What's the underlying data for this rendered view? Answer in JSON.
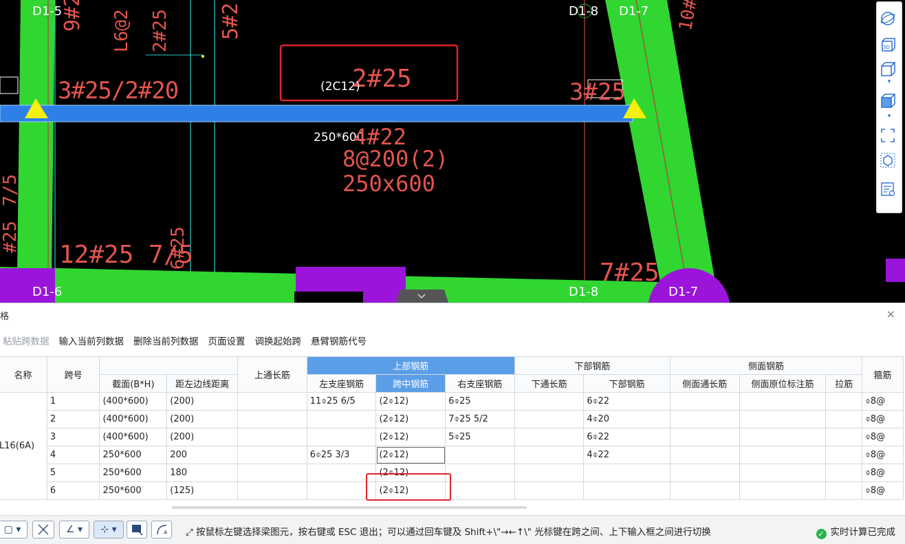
{
  "cad": {
    "axis_labels": [
      "D1-5",
      "D1-8",
      "D1-7",
      "D1-6",
      "D1-8",
      "D1-7"
    ],
    "texts": {
      "beam_top_left": "3#25/2#20",
      "beam_mid_top": "2#25",
      "beam_mid_top_overlay": "(2C12)",
      "beam_top_right": "3#25",
      "section_overlay": "250*600",
      "red_mid1": "4#22",
      "red_mid2": "8@200(2)",
      "red_mid3": "250x600",
      "bottom_left": "12#25 7/5",
      "bottom_left2": "6#25",
      "bottom_right": "7#25",
      "top_left_v1": "9#2",
      "top_left_v2": "L6@2",
      "top_left_v3": "2#25",
      "top_mid_v": "5#2",
      "top_right_v": "10#1",
      "left_v": "7/5",
      "left_v2": "#25"
    },
    "colors": {
      "beam_green": "#31d631",
      "beam_blue": "#2f7fe8",
      "purple": "#9a15d9",
      "red_text": "#e2554e",
      "annotation_box": "#e0242a"
    }
  },
  "right_toolbar": {
    "icons": [
      "orbit-icon",
      "view-3d-icon",
      "cube-wire-icon",
      "cube-solid-icon",
      "fit-view-icon",
      "iso-view-icon",
      "properties-icon"
    ]
  },
  "panel": {
    "title": "格",
    "close": "×",
    "menu": [
      "粘贴跨数据",
      "输入当前列数据",
      "删除当前列数据",
      "页面设置",
      "调换起始跨",
      "悬臂钢筋代号"
    ],
    "headers": {
      "name": "名称",
      "span": "跨号",
      "section": "截面(B*H)",
      "dist": "距左边线距离",
      "top_through": "上通长筋",
      "top_group": "上部钢筋",
      "left_support": "左支座钢筋",
      "mid_span": "跨中钢筋",
      "right_support": "右支座钢筋",
      "bottom_group": "下部钢筋",
      "bottom_through": "下通长筋",
      "bottom_bar": "下部钢筋",
      "side_group": "侧面钢筋",
      "side_through": "侧面通长筋",
      "side_in_place": "侧面原位标注筋",
      "tie": "拉筋",
      "stirrup": "箍筋"
    },
    "beam_name": "L16(6A)",
    "rows": [
      {
        "span": "1",
        "section": "(400*600)",
        "dist": "(200)",
        "top_through": "",
        "left": "11⌽25 6/5",
        "mid": "(2⌽12)",
        "right": "6⌽25",
        "bot_through": "",
        "bot": "6⌽22",
        "side_through": "",
        "side_inplace": "",
        "tie": "",
        "stirrup": "⌽8@"
      },
      {
        "span": "2",
        "section": "(400*600)",
        "dist": "(200)",
        "top_through": "",
        "left": "",
        "mid": "(2⌽12)",
        "right": "7⌽25 5/2",
        "bot_through": "",
        "bot": "4⌽20",
        "side_through": "",
        "side_inplace": "",
        "tie": "",
        "stirrup": "⌽8@"
      },
      {
        "span": "3",
        "section": "(400*600)",
        "dist": "(200)",
        "top_through": "",
        "left": "",
        "mid": "(2⌽12)",
        "right": "5⌽25",
        "bot_through": "",
        "bot": "6⌽22",
        "side_through": "",
        "side_inplace": "",
        "tie": "",
        "stirrup": "⌽8@"
      },
      {
        "span": "4",
        "section": "250*600",
        "dist": "200",
        "top_through": "",
        "left": "6⌽25 3/3",
        "mid": "(2⌽12)",
        "right": "",
        "bot_through": "",
        "bot": "4⌽22",
        "side_through": "",
        "side_inplace": "",
        "tie": "",
        "stirrup": "⌽8@"
      },
      {
        "span": "5",
        "section": "250*600",
        "dist": "180",
        "top_through": "",
        "left": "",
        "mid": "(2⌽12)",
        "right": "",
        "bot_through": "",
        "bot": "",
        "side_through": "",
        "side_inplace": "",
        "tie": "",
        "stirrup": "⌽8@"
      },
      {
        "span": "6",
        "section": "250*600",
        "dist": "(125)",
        "top_through": "",
        "left": "",
        "mid": "(2⌽12)",
        "right": "",
        "bot_through": "",
        "bot": "",
        "side_through": "",
        "side_inplace": "",
        "tie": "",
        "stirrup": "⌽8@"
      }
    ]
  },
  "statusbar": {
    "hint": "按鼠标左键选择梁图元，按右键或 ESC 退出；可以通过回车键及 Shift+\\\"→←↑\\\" 光标键在跨之间、上下输入框之间进行切换",
    "status": "实时计算已完成"
  }
}
